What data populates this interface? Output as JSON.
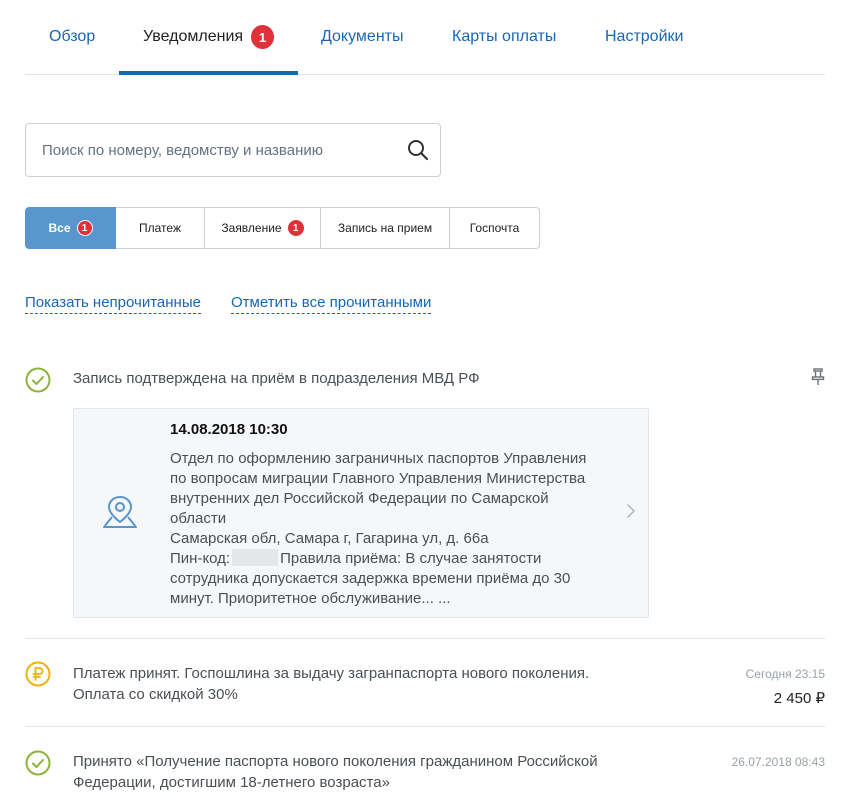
{
  "tabs": [
    {
      "label": "Обзор"
    },
    {
      "label": "Уведомления",
      "badge": "1"
    },
    {
      "label": "Документы"
    },
    {
      "label": "Карты оплаты"
    },
    {
      "label": "Настройки"
    }
  ],
  "search": {
    "placeholder": "Поиск по номеру, ведомству и названию"
  },
  "filters": [
    {
      "label": "Все",
      "badge": "1"
    },
    {
      "label": "Платеж"
    },
    {
      "label": "Заявление",
      "badge": "1"
    },
    {
      "label": "Запись на прием"
    },
    {
      "label": "Госпочта"
    }
  ],
  "actions": {
    "show_unread": "Показать непрочитанные",
    "mark_all_read": "Отметить все прочитанными"
  },
  "notifications": [
    {
      "title": "Запись подтверждена на приём в подразделения МВД РФ",
      "card": {
        "datetime": "14.08.2018 10:30",
        "line1": "Отдел по оформлению заграничных паспортов Управления по вопросам миграции Главного Управления Министерства внутренних дел Российской Федерации по Самарской области",
        "line2": "Самарская обл, Самара г, Гагарина ул, д. 66а",
        "pin_prefix": "Пин-код:",
        "line3": "Правила приёма: В случае занятости сотрудника допускается задержка времени приёма до 30 минут. Приоритетное обслуживание... ..."
      }
    },
    {
      "title": "Платеж принят. Госпошлина за выдачу загранпаспорта нового поколения. Оплата со скидкой 30%",
      "date": "Сегодня 23:15",
      "amount": "2 450 ₽"
    },
    {
      "title": "Принято «Получение паспорта нового поколения гражданином Российской Федерации, достигшим 18-летнего возраста»",
      "date": "26.07.2018 08:43"
    }
  ],
  "colors": {
    "accent": "#0d6db3",
    "badge": "#e0303a",
    "success": "#8eb33b",
    "payment": "#f0b400",
    "filter_active": "#5996cd"
  },
  "icons": [
    "search-icon",
    "check-circle-icon",
    "pin-icon",
    "location-icon",
    "chevron-right-icon",
    "ruble-circle-icon"
  ]
}
